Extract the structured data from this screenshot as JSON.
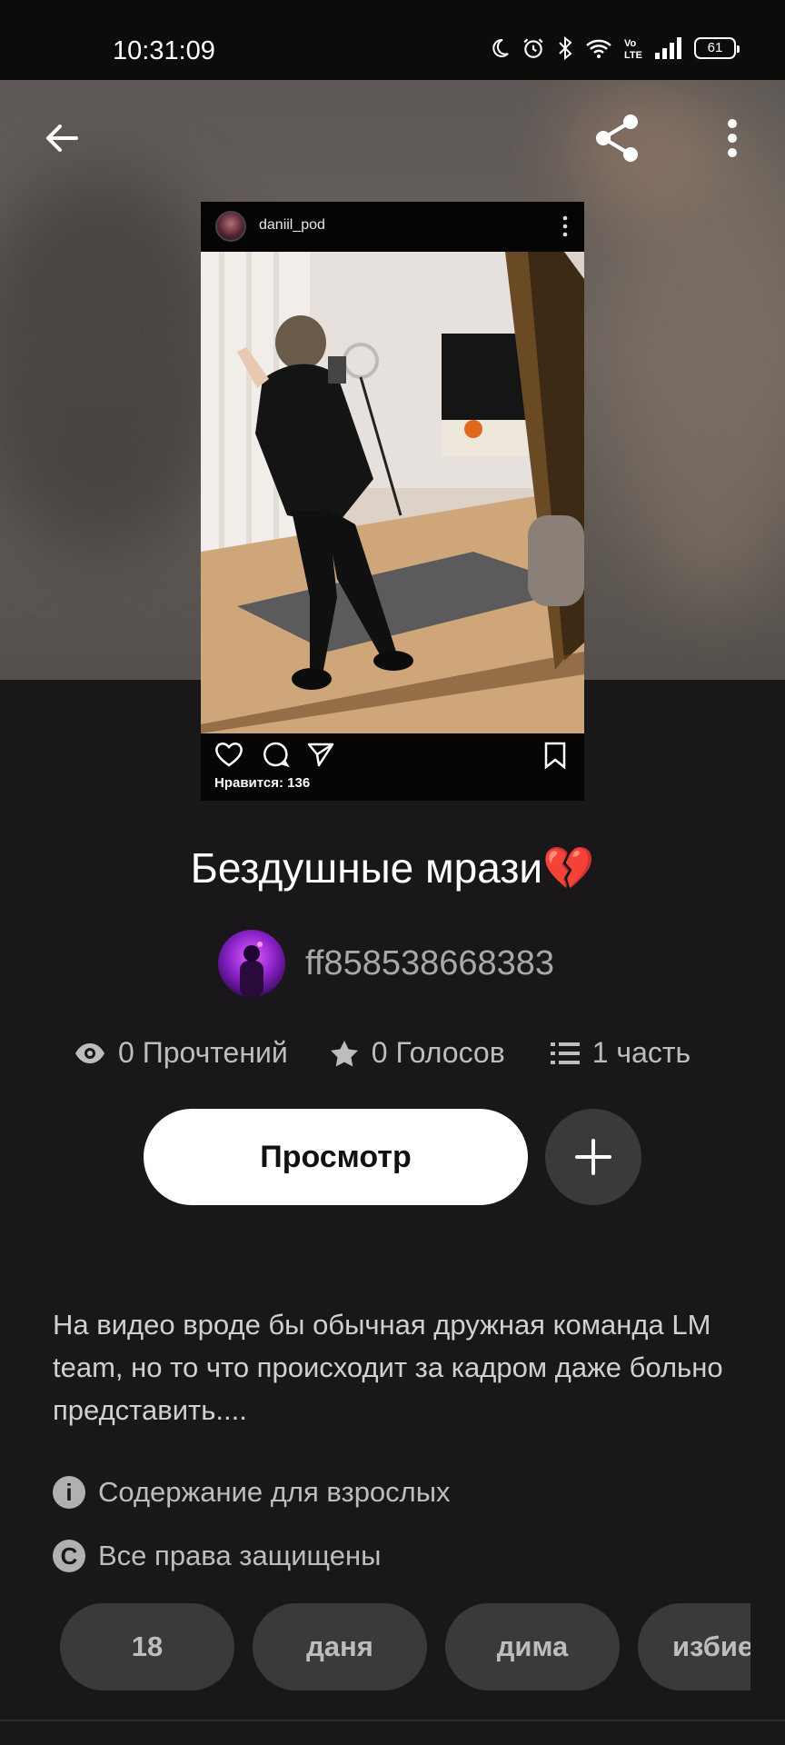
{
  "status_bar": {
    "time": "10:31:09",
    "icons": [
      "moon-icon",
      "alarm-icon",
      "bluetooth-icon",
      "wifi-icon",
      "volte-icon",
      "signal-icon"
    ],
    "volte": "Vo LTE",
    "battery": "61"
  },
  "toolbar": {
    "back_icon": "back-arrow-icon",
    "share_icon": "share-icon",
    "menu_icon": "more-vertical-icon"
  },
  "cover": {
    "username": "daniil_pod",
    "likes": "Нравится: 136"
  },
  "story": {
    "title": "Бездушные мрази💔",
    "author": "ff858538668383",
    "stats": {
      "reads": "0 Прочтений",
      "votes": "0 Голосов",
      "parts": "1 часть"
    },
    "read_button": "Просмотр",
    "description": "На видео вроде бы обычная дружная команда LM team, но то что происходит за кадром даже больно представить....",
    "mature_label": "Содержание для взрослых",
    "copyright_label": "Все права защищены",
    "tags": [
      "18",
      "даня",
      "дима",
      "избие"
    ]
  },
  "colors": {
    "background": "#19171a",
    "button_bg": "#ffffff",
    "chip_bg": "#3a393c",
    "muted_text": "#bdbdbf"
  }
}
